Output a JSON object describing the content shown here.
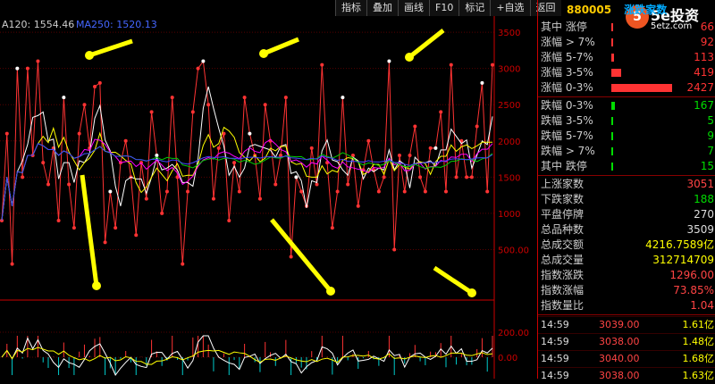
{
  "ma_label": "A120: 1554.46",
  "ma_label2": "MA250: 1520.13",
  "toolbar": [
    "指标",
    "叠加",
    "画线",
    "F10",
    "标记",
    "+自选",
    "返回"
  ],
  "header": {
    "code": "880005",
    "name": "涨跌家数"
  },
  "logo": {
    "mark": "5",
    "text": "5e投资",
    "sub": "5etz.com"
  },
  "up_rows": [
    {
      "label": "其中 涨停",
      "value": "66",
      "frac": 0.02,
      "color": "#ff3333"
    },
    {
      "label": "涨幅 > 7%",
      "value": "92",
      "frac": 0.03,
      "color": "#ff3333"
    },
    {
      "label": "涨幅 5-7%",
      "value": "113",
      "frac": 0.04,
      "color": "#ff3333"
    },
    {
      "label": "涨幅 3-5%",
      "value": "419",
      "frac": 0.15,
      "color": "#ff3333"
    },
    {
      "label": "涨幅 0-3%",
      "value": "2427",
      "frac": 0.95,
      "color": "#ff3333"
    }
  ],
  "down_rows": [
    {
      "label": "跌幅 0-3%",
      "value": "167",
      "frac": 0.06,
      "color": "#00dd00"
    },
    {
      "label": "跌幅 3-5%",
      "value": "5",
      "frac": 0.01,
      "color": "#00dd00"
    },
    {
      "label": "跌幅 5-7%",
      "value": "9",
      "frac": 0.01,
      "color": "#00dd00"
    },
    {
      "label": "跌幅 > 7%",
      "value": "7",
      "frac": 0.01,
      "color": "#00dd00"
    },
    {
      "label": "其中 跌停",
      "value": "15",
      "frac": 0.01,
      "color": "#00dd00"
    }
  ],
  "stats": [
    {
      "label": "上涨家数",
      "value": "3051",
      "color": "#ff4444"
    },
    {
      "label": "下跌家数",
      "value": "188",
      "color": "#00dd00"
    },
    {
      "label": "平盘停牌",
      "value": "270",
      "color": "#dddddd"
    },
    {
      "label": "总品种数",
      "value": "3509",
      "color": "#dddddd"
    },
    {
      "label": "总成交额",
      "value": "4216.7589亿",
      "color": "#ffff00"
    },
    {
      "label": "总成交量",
      "value": "312714709",
      "color": "#ffff00"
    },
    {
      "label": "指数涨跌",
      "value": "1296.00",
      "color": "#ff4444"
    },
    {
      "label": "指数涨幅",
      "value": "73.85%",
      "color": "#ff4444"
    },
    {
      "label": "指数量比",
      "value": "1.04",
      "color": "#ff4444"
    }
  ],
  "ticks": [
    {
      "time": "14:59",
      "price": "3039.00",
      "vol": "1.61亿"
    },
    {
      "time": "14:59",
      "price": "3038.00",
      "vol": "1.48亿"
    },
    {
      "time": "14:59",
      "price": "3040.00",
      "vol": "1.68亿"
    },
    {
      "time": "14:59",
      "price": "3038.00",
      "vol": "1.63亿"
    }
  ],
  "axis": {
    "main_ticks": [
      "3500",
      "3000",
      "2500",
      "2000",
      "1500",
      "1000",
      "500.00"
    ],
    "sub_ticks": [
      "200.00",
      "0.00"
    ]
  },
  "chart_data": {
    "type": "line",
    "ylim": [
      0,
      3600
    ],
    "series": [
      {
        "values": [
          900,
          2100,
          300,
          3000,
          1500,
          3000,
          1800,
          3100,
          1700,
          1400,
          1900,
          900,
          2600,
          1400,
          800,
          2100,
          2500,
          1900,
          2750,
          2800,
          600,
          1300,
          800,
          1700,
          2000,
          1500,
          700,
          1700,
          1200,
          2400,
          1800,
          1000,
          1300,
          2600,
          1500,
          300,
          1300,
          2400,
          3000,
          3100,
          2500,
          1200,
          1900,
          2100,
          900,
          1700,
          1300,
          2600,
          2100,
          1800,
          1200,
          2500,
          2000,
          1400,
          1800,
          2600,
          400,
          1500,
          1300,
          1100,
          1900,
          1400,
          3050,
          1700,
          800,
          1300,
          2600,
          1400,
          1800,
          1100,
          1600,
          2000,
          1600,
          1300,
          1500,
          3100,
          500,
          1800,
          1300,
          1800,
          2200,
          1500,
          1300,
          1900,
          1900,
          2400,
          1300,
          3050,
          1500,
          2000,
          1500,
          1500,
          2200,
          2800,
          1300,
          3050
        ]
      }
    ]
  },
  "colors": {
    "up": "#ff3333",
    "down": "#00dd00",
    "grid": "#550000",
    "white": "#ffffff",
    "yellow": "#ffff00",
    "magenta": "#ff00ff",
    "blue": "#4444ff"
  }
}
